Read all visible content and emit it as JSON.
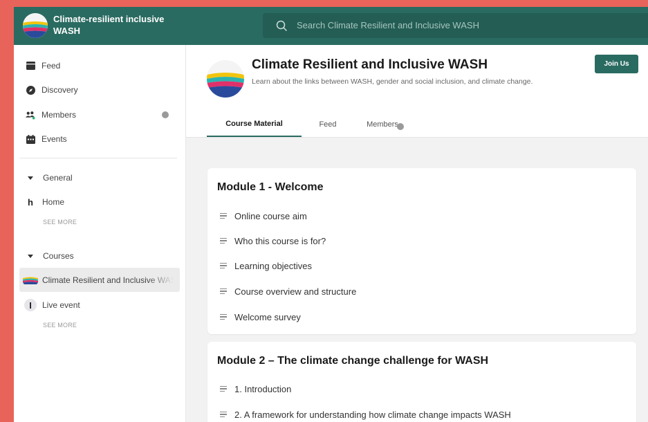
{
  "app": {
    "name": "Climate-resilient inclusive WASH",
    "search_placeholder": "Search Climate Resilient and Inclusive WASH"
  },
  "sidebar": {
    "nav": [
      {
        "label": "Feed",
        "icon": "feed-icon"
      },
      {
        "label": "Discovery",
        "icon": "compass-icon"
      },
      {
        "label": "Members",
        "icon": "members-icon",
        "badge": true
      },
      {
        "label": "Events",
        "icon": "calendar-icon"
      }
    ],
    "general": {
      "label": "General",
      "items": [
        {
          "label": "Home",
          "avatar": "h"
        }
      ],
      "see_more": "SEE MORE"
    },
    "courses": {
      "label": "Courses",
      "items": [
        {
          "label": "Climate Resilient and Inclusive WASH",
          "active": true
        },
        {
          "label": "Live event",
          "avatar": "I"
        }
      ],
      "see_more": "SEE MORE"
    }
  },
  "course": {
    "title": "Climate Resilient and Inclusive WASH",
    "description": "Learn about the links between WASH, gender and social inclusion, and climate change.",
    "join_label": "Join Us",
    "tabs": [
      {
        "label": "Course Material",
        "active": true
      },
      {
        "label": "Feed",
        "active": false
      },
      {
        "label": "Members",
        "active": false,
        "badge": true
      }
    ]
  },
  "modules": [
    {
      "title": "Module 1 - Welcome",
      "lessons": [
        "Online course aim",
        "Who this course is for?",
        "Learning objectives",
        "Course overview and structure",
        "Welcome survey"
      ]
    },
    {
      "title": "Module 2 – The climate change challenge for WASH",
      "lessons": [
        "1. Introduction",
        "2. A framework for understanding how climate change impacts WASH"
      ]
    }
  ],
  "colors": {
    "brand": "#2a6b61",
    "background": "#e8645a",
    "logo_stripes": [
      "#f1c40f",
      "#2bb3b1",
      "#e0306a",
      "#2a4b9b"
    ]
  }
}
